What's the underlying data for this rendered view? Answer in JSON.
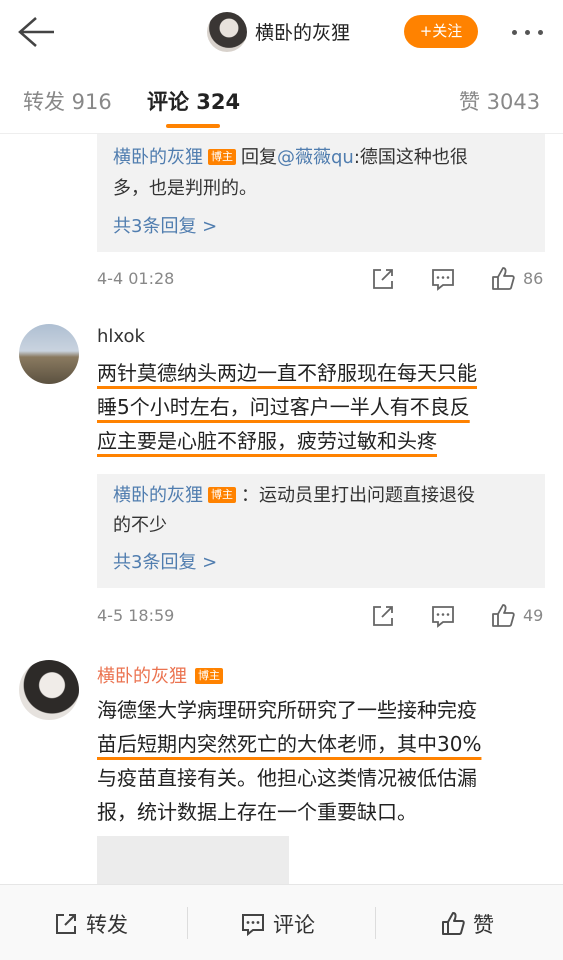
{
  "header": {
    "title": "横卧的灰狸",
    "follow_label": "+关注"
  },
  "tabs": [
    {
      "label": "转发 916"
    },
    {
      "label": "评论 324"
    },
    {
      "label": "赞 3043"
    }
  ],
  "thread0": {
    "reply": {
      "author": "横卧的灰狸",
      "badge": "博主",
      "prefix": "回复",
      "mention": "@薇薇qu",
      "text_line1": ":德国这种也很",
      "text_line2": "多，也是判刑的。"
    },
    "more_replies": "共3条回复 >",
    "time": "4-4 01:28",
    "likes": "86"
  },
  "comment1": {
    "author": "hlxok",
    "text_lines": [
      "两针莫德纳头两边一直不舒服现在每天只能",
      "睡5个小时左右，问过客户一半人有不良反",
      "应主要是心脏不舒服，疲劳过敏和头疼"
    ],
    "reply": {
      "author": "横卧的灰狸",
      "badge": "博主",
      "text_line1": "：运动员里打出问题直接退役",
      "text_line2": "的不少"
    },
    "more_replies": "共3条回复 >",
    "time": "4-5 18:59",
    "likes": "49"
  },
  "comment2": {
    "author": "横卧的灰狸",
    "badge": "博主",
    "text_lines": [
      "海德堡大学病理研究所研究了一些接种完疫",
      "苗后短期内突然死亡的大体老师，其中30%",
      "与疫苗直接有关。他担心这类情况被低估漏",
      "报，统计数据上存在一个重要缺口。"
    ]
  },
  "bottom_bar": {
    "repost": "转发",
    "comment": "评论",
    "like": "赞"
  },
  "colors": {
    "accent": "#ff8200",
    "link": "#507daf",
    "username": "#eb7350"
  }
}
